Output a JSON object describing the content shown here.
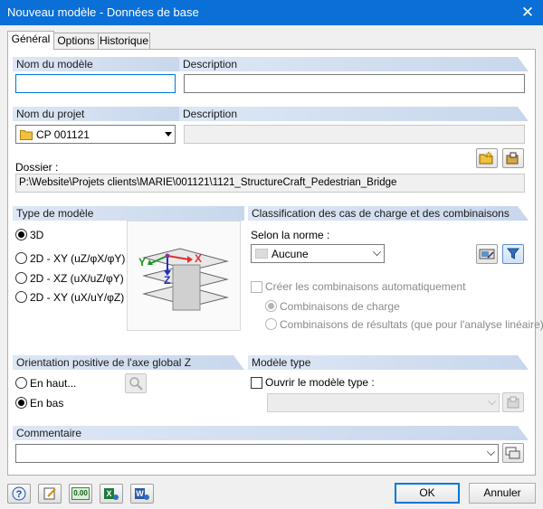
{
  "window": {
    "title": "Nouveau modèle - Données de base",
    "close_glyph": "✕"
  },
  "tabs": [
    {
      "label": "Général",
      "active": true
    },
    {
      "label": "Options",
      "active": false
    },
    {
      "label": "Historique",
      "active": false
    }
  ],
  "model": {
    "name_label": "Nom du modèle",
    "name_value": "",
    "description_label": "Description",
    "description_value": ""
  },
  "project": {
    "name_label": "Nom du projet",
    "selected": "CP 001121",
    "description_label": "Description",
    "description_value": "",
    "folder_label": "Dossier :",
    "folder_value": "P:\\Website\\Projets clients\\MARIE\\001121\\1121_StructureCraft_Pedestrian_Bridge"
  },
  "model_type": {
    "header": "Type de modèle",
    "options": [
      {
        "label": "3D",
        "selected": true
      },
      {
        "label": "2D - XY (uZ/φX/φY)",
        "selected": false
      },
      {
        "label": "2D - XZ (uX/uZ/φY)",
        "selected": false
      },
      {
        "label": "2D - XY (uX/uY/φZ)",
        "selected": false
      }
    ],
    "axis_labels": {
      "x": "X",
      "y": "Y",
      "z": "Z"
    }
  },
  "classification": {
    "header": "Classification des cas de charge et des combinaisons",
    "norm_label": "Selon la norme :",
    "norm_selected": "Aucune",
    "auto_combinations_label": "Créer les combinaisons automatiquement",
    "load_combinations_label": "Combinaisons de charge",
    "result_combinations_label": "Combinaisons de résultats (que pour l'analyse linéaire)"
  },
  "orientation": {
    "header": "Orientation positive de l'axe global Z",
    "options": [
      {
        "label": "En haut...",
        "selected": false
      },
      {
        "label": "En bas",
        "selected": true
      }
    ]
  },
  "template": {
    "header": "Modèle type",
    "open_label": "Ouvrir le modèle type :",
    "selected": ""
  },
  "comment": {
    "header": "Commentaire",
    "value": ""
  },
  "footer": {
    "ok_label": "OK",
    "cancel_label": "Annuler",
    "units_icon_text": "0.00"
  },
  "colors": {
    "title_bar": "#0a6fd6",
    "section_header": "#d3dff0",
    "accent_blue": "#0078d7",
    "axis_x": "#e03030",
    "axis_y": "#1a9a1a",
    "axis_z": "#2030c0",
    "folder": "#f0c040"
  }
}
